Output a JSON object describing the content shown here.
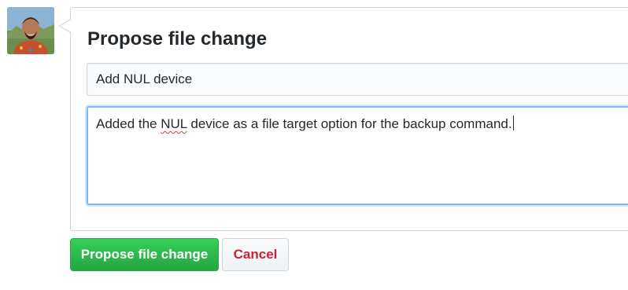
{
  "user": {
    "avatar_icon": "user-avatar-icon"
  },
  "form": {
    "title": "Propose file change",
    "summary_value": "Add NUL device",
    "description_before": "Added the ",
    "description_misspelled": "NUL",
    "description_after": " device as a file target option for the backup command."
  },
  "actions": {
    "propose_label": "Propose file change",
    "cancel_label": "Cancel"
  },
  "colors": {
    "primary_button": "#28a745",
    "cancel_text": "#cb2431",
    "focus_border": "#79b8ff"
  }
}
